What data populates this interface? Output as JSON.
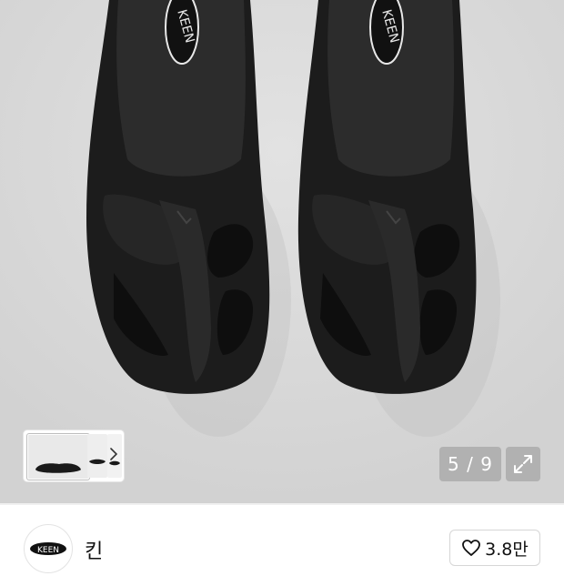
{
  "gallery": {
    "image_alt": "",
    "counter": "5 / 9",
    "thumbnail_count": 3
  },
  "brand": {
    "logo_text": "KEEN",
    "name": "킨"
  },
  "like": {
    "count": "3.8만"
  },
  "icons": {
    "thumb_next": "chevron-right-icon",
    "expand": "expand-icon",
    "heart": "heart-icon"
  },
  "colors": {
    "product": "#1a1a1a",
    "background": "#d9d9d9"
  }
}
